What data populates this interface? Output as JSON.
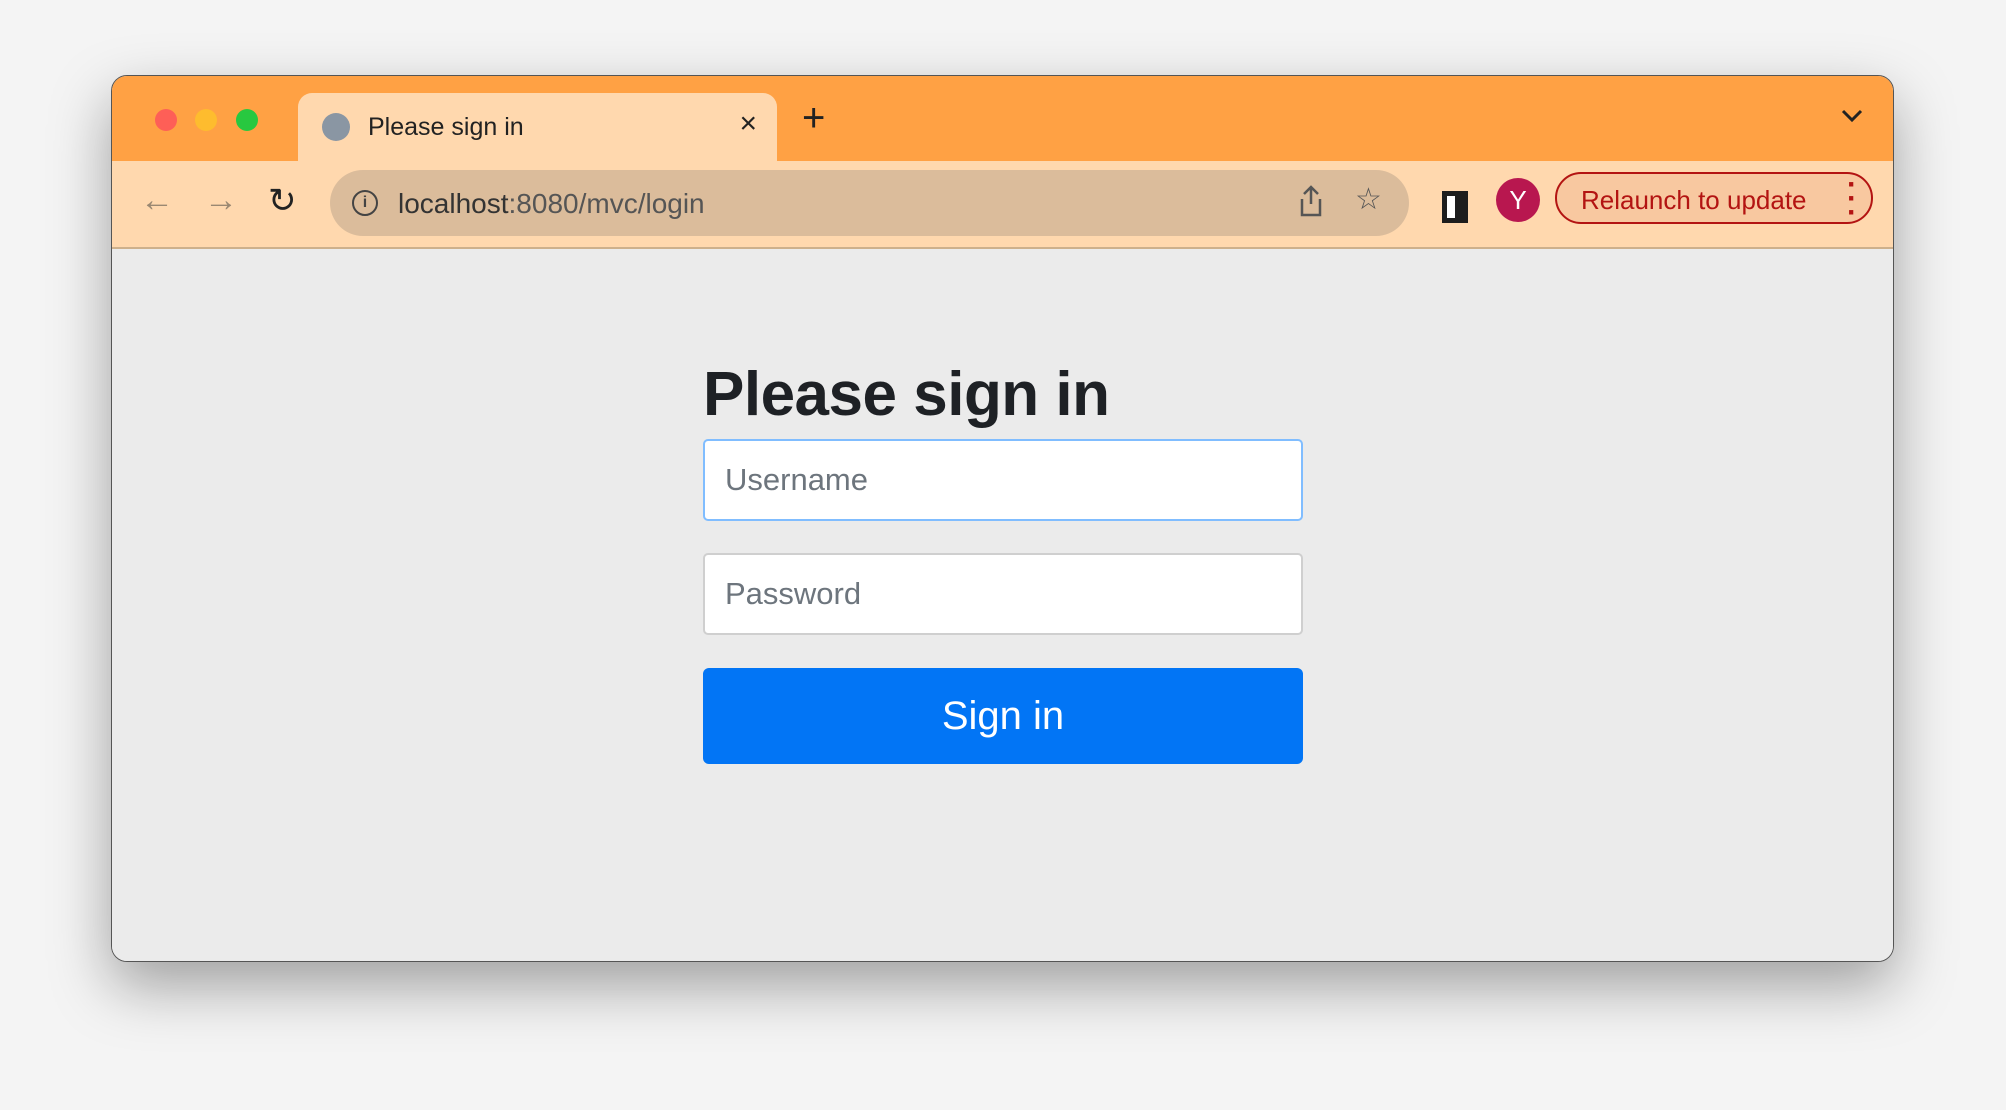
{
  "browser": {
    "tab_title": "Please sign in",
    "tab_close": "×",
    "new_tab": "+",
    "tab_menu": "⌄",
    "url_host": "localhost",
    "url_rest": ":8080/mvc/login",
    "avatar_letter": "Y",
    "relaunch_label": "Relaunch to update",
    "colors": {
      "tabstrip": "#ffa144",
      "toolbar": "#ffd8ae",
      "relaunch": "#b31412",
      "avatar": "#b8174f"
    }
  },
  "page": {
    "heading": "Please sign in",
    "username_placeholder": "Username",
    "password_placeholder": "Password",
    "submit_label": "Sign in",
    "colors": {
      "primary": "#0275f5",
      "background": "#ebebeb"
    }
  }
}
